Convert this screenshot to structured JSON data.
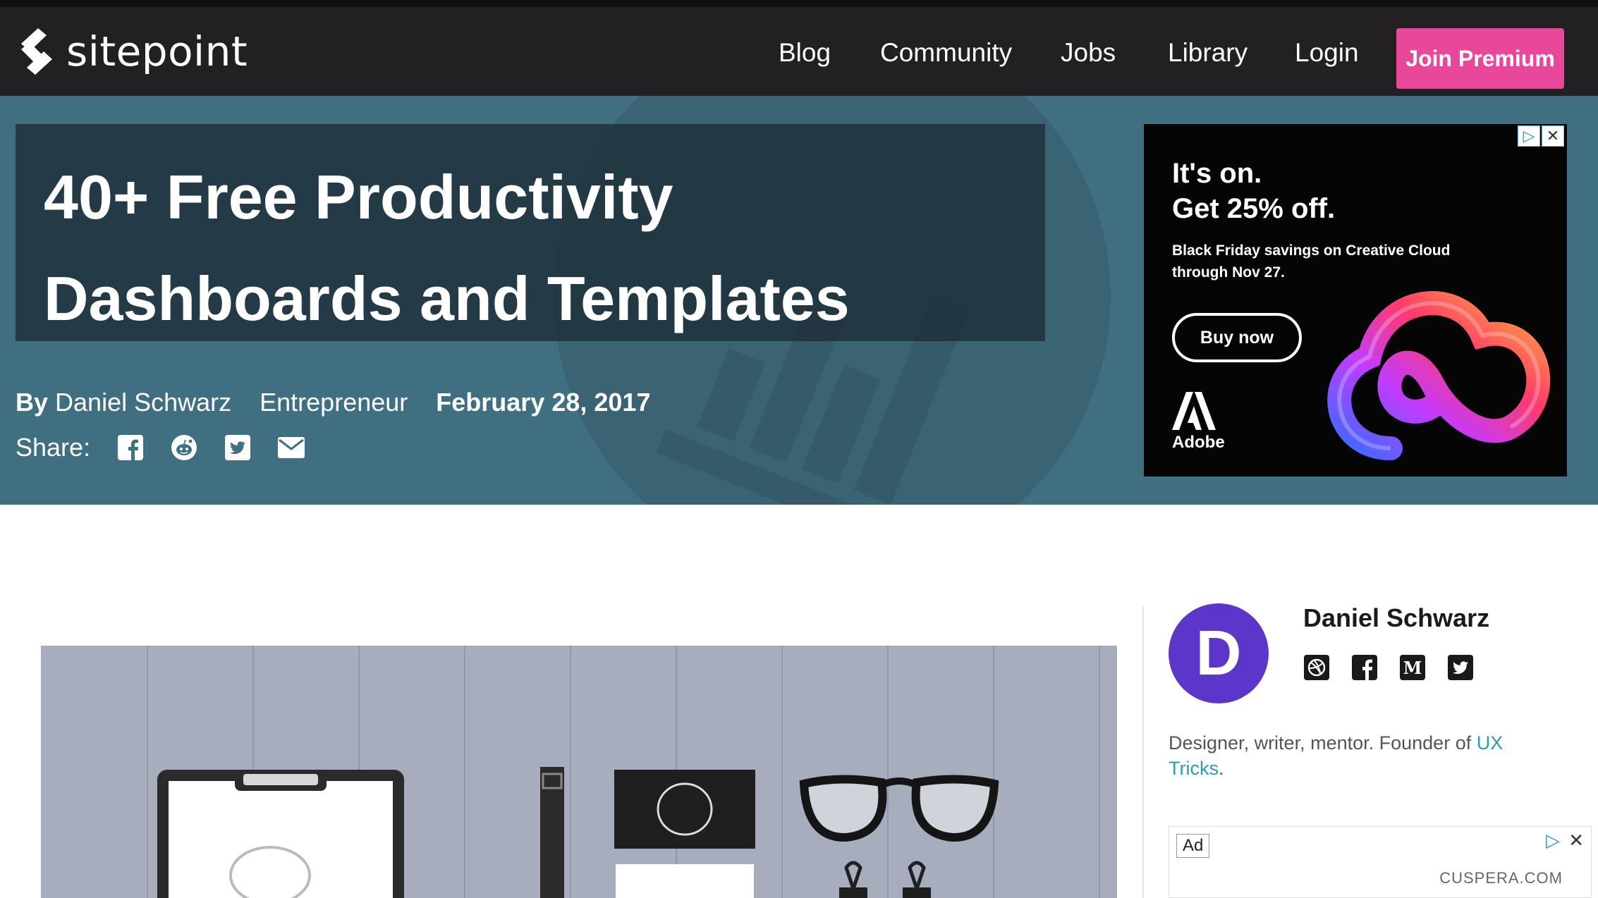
{
  "brand": {
    "name": "sitepoint",
    "accent": "#e8479a",
    "nav_bg": "#232024",
    "hero_bg": "#3f6f80"
  },
  "nav": {
    "links": [
      "Blog",
      "Community",
      "Jobs",
      "Library",
      "Login"
    ],
    "cta": "Join Premium"
  },
  "article": {
    "title": "40+ Free Productivity Dashboards and Templates",
    "by_label": "By",
    "author": "Daniel Schwarz",
    "category": "Entrepreneur",
    "date": "February 28, 2017",
    "share_label": "Share:",
    "share_icons": [
      "facebook-icon",
      "reddit-icon",
      "twitter-icon",
      "email-icon"
    ]
  },
  "ad_top": {
    "headline1": "It's on.",
    "headline2": "Get 25% off.",
    "body": "Black Friday savings on Creative Cloud through Nov 27.",
    "button": "Buy now",
    "brand": "Adobe",
    "adchoices_symbol": "▷",
    "close_symbol": "✕"
  },
  "sidebar": {
    "avatar_letter": "D",
    "avatar_color": "#5c35c9",
    "author_name": "Daniel Schwarz",
    "social_icons": [
      "dribbble-icon",
      "facebook-icon",
      "medium-icon",
      "twitter-icon"
    ],
    "medium_glyph": "M",
    "bio_prefix": "Designer, writer, mentor. Founder of ",
    "bio_link": "UX Tricks",
    "bio_suffix": "."
  },
  "ad_side": {
    "tag": "Ad",
    "host": "CUSPERA.COM",
    "adchoices_symbol": "▷",
    "close_symbol": "✕"
  }
}
